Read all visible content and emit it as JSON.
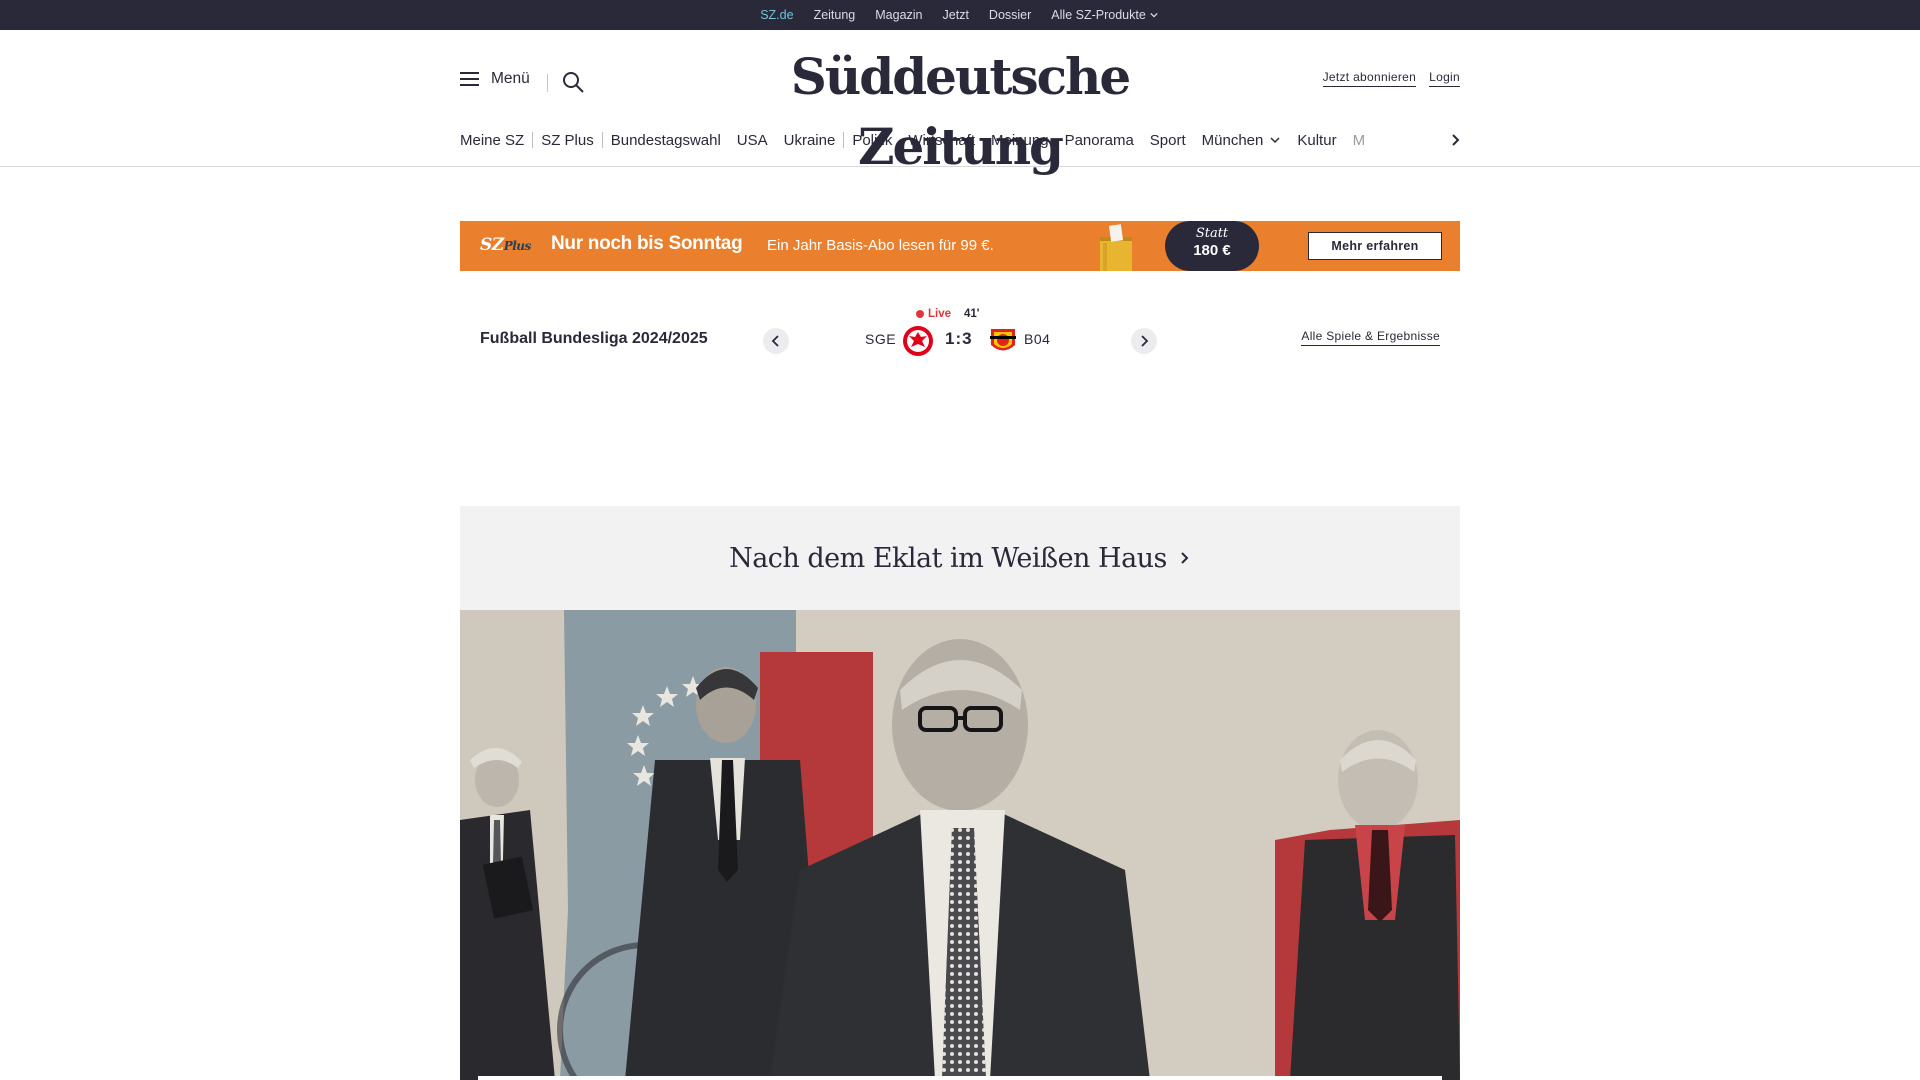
{
  "topbar": {
    "items": [
      {
        "label": "SZ.de"
      },
      {
        "label": "Zeitung"
      },
      {
        "label": "Magazin"
      },
      {
        "label": "Jetzt"
      },
      {
        "label": "Dossier"
      },
      {
        "label": "Alle SZ-Produkte"
      }
    ]
  },
  "header": {
    "menu_label": "Menü",
    "logo": "Süddeutsche Zeitung",
    "subscribe_label": "Jetzt abonnieren",
    "login_label": "Login"
  },
  "nav": {
    "items": [
      "Meine SZ",
      "SZ Plus",
      "Bundestagswahl",
      "USA",
      "Ukraine",
      "Politik",
      "Wirtschaft",
      "Meinung",
      "Panorama",
      "Sport",
      "München",
      "Kultur",
      "M"
    ]
  },
  "promo": {
    "logo_main": "SZ",
    "logo_suffix": "Plus",
    "headline": "Nur noch bis Sonntag",
    "subline": "Ein Jahr Basis-Abo lesen für 99 €.",
    "badge_top": "Statt",
    "badge_price": "180 €",
    "button_label": "Mehr erfahren",
    "bg_color": "#ea7f2d"
  },
  "ticker": {
    "title": "Fußball Bundesliga 2024/2025",
    "live_label": "Live",
    "minute": "41'",
    "home_team": "SGE",
    "away_team": "B04",
    "score": "1:3",
    "all_games_label": "Alle Spiele & Ergebnisse",
    "live_color": "#e0353a"
  },
  "topic": {
    "title": "Nach dem Eklat im Weißen Haus"
  },
  "colors": {
    "dark": "#29293a",
    "topbar_active": "#71c3d8",
    "topic_bg": "#f2f2f2"
  }
}
